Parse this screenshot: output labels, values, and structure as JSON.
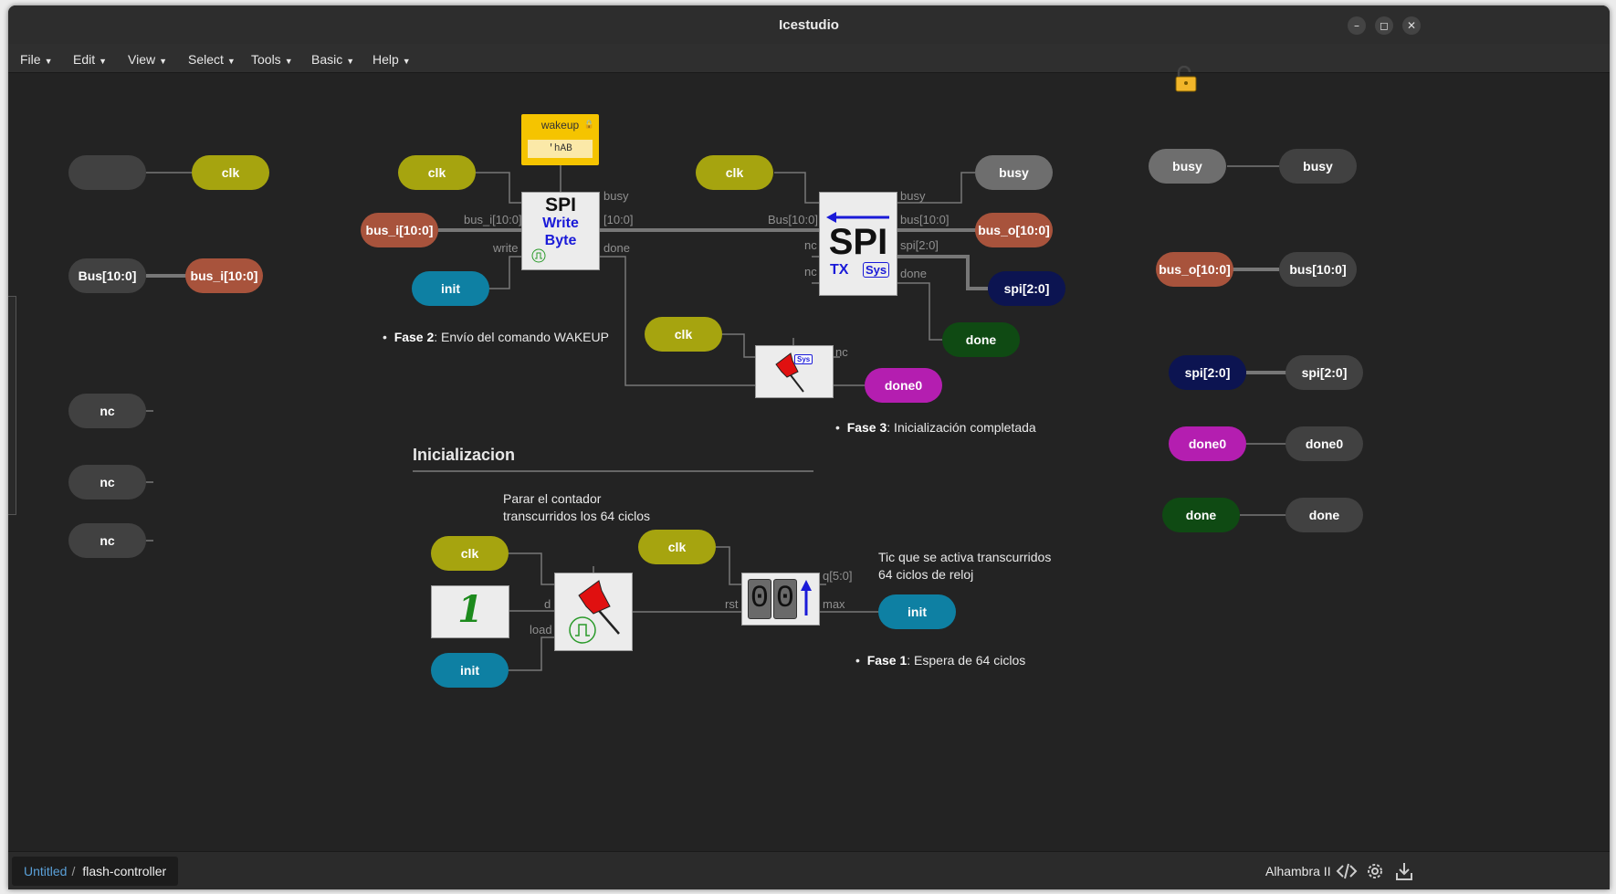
{
  "window": {
    "title": "Icestudio"
  },
  "menu": [
    {
      "label": "File"
    },
    {
      "label": "Edit"
    },
    {
      "label": "View"
    },
    {
      "label": "Select"
    },
    {
      "label": "Tools"
    },
    {
      "label": "Basic"
    },
    {
      "label": "Help"
    }
  ],
  "pills": {
    "l_clk": "clk",
    "l_bus": "Bus[10:0]",
    "l_busi": "bus_i[10:0]",
    "l_nc1": "nc",
    "l_nc2": "nc",
    "l_nc3": "nc",
    "w_clk": "clk",
    "w_busi": "bus_i[10:0]",
    "w_init": "init",
    "t_clk": "clk",
    "t_busy": "busy",
    "t_buso": "bus_o[10:0]",
    "t_spi": "spi[2:0]",
    "t_done": "done",
    "d_clk": "clk",
    "d_done0": "done0",
    "i_clk": "clk",
    "i_init": "init",
    "i_clk2": "clk",
    "i_init2": "init",
    "r_busy1": "busy",
    "r_busy2": "busy",
    "r_buso": "bus_o[10:0]",
    "r_bus": "bus[10:0]",
    "r_spi1": "spi[2:0]",
    "r_spi2": "spi[2:0]",
    "r_done01": "done0",
    "r_done02": "done0",
    "r_done1": "done",
    "r_done2": "done"
  },
  "ports": {
    "w_busy": "busy",
    "w_bus_in": "bus_i[10:0]",
    "w_bus_out": "[10:0]",
    "w_write": "write",
    "w_done": "done",
    "t_busy": "busy",
    "t_bus_in": "Bus[10:0]",
    "t_bus_out": "bus[10:0]",
    "t_nc1": "nc",
    "t_nc2": "nc",
    "t_spi": "spi[2:0]",
    "t_done": "done",
    "d_nc": "nc",
    "i_d": "d",
    "i_load": "load",
    "c_rst": "rst",
    "c_q": "q[5:0]",
    "c_max": "max"
  },
  "const_block": {
    "name": "wakeup",
    "value": "'hAB"
  },
  "blocks": {
    "write_byte": [
      "SPI",
      "Write",
      "Byte"
    ],
    "spi_tx": {
      "big": "SPI",
      "tx": "TX",
      "sys": "Sys"
    },
    "sys_small": "Sys",
    "counter_digits": [
      "0",
      "0"
    ],
    "one": "1"
  },
  "texts": {
    "fase2_b": "Fase 2",
    "fase2": ": Envío del comando WAKEUP",
    "fase3_b": "Fase 3",
    "fase3": ": Inicialización completada",
    "fase1_b": "Fase 1",
    "fase1": ": Espera de 64 ciclos",
    "section": "Inicializacion",
    "parar1": "Parar el contador",
    "parar2": "transcurridos los 64 ciclos",
    "tic1": "Tic que se activa transcurridos",
    "tic2": "64 ciclos de reloj"
  },
  "status": {
    "crumb_root": "Untitled",
    "crumb_sep": "/",
    "crumb_current": "flash-controller",
    "board": "Alhambra II"
  },
  "icons": [
    "lock-open-icon",
    "code-icon",
    "gear-icon",
    "download-icon"
  ],
  "colors": {
    "clk": "#a6a40f",
    "bus": "#a8533c",
    "init": "#0e80a3",
    "spi": "#0c1451",
    "done": "#0f4a13",
    "done0": "#b41eb0",
    "wire": "#777777"
  }
}
